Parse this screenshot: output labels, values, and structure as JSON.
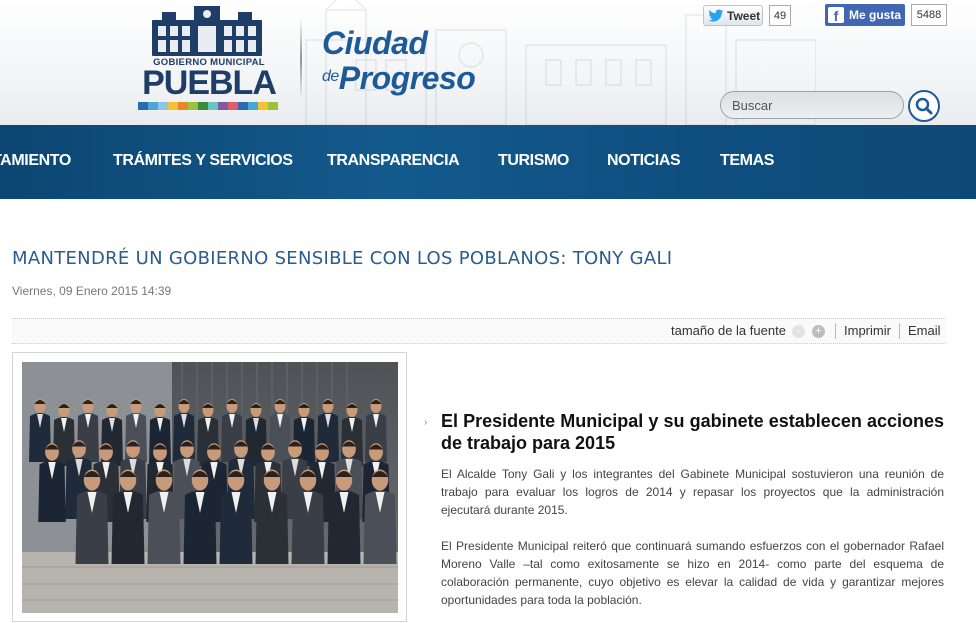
{
  "header": {
    "logo": {
      "line1": "GOBIERNO MUNICIPAL",
      "line2": "PUEBLA",
      "stripe_colors": [
        "#2b6cb0",
        "#49a7d8",
        "#8fc5e8",
        "#f2c230",
        "#e7862a",
        "#9bc23c",
        "#3b8c3a",
        "#6cc4c0",
        "#7c5aa6",
        "#e05b6c",
        "#2b6cb0",
        "#49a7d8",
        "#f2c230",
        "#9bc23c"
      ]
    },
    "slogan_line1": "Ciudad",
    "slogan_de": "de",
    "slogan_line2": "Progreso"
  },
  "social": {
    "tweet_label": "Tweet",
    "tweet_count": "49",
    "tweet_icon": "twitter-bird-icon",
    "like_label": "Me gusta",
    "like_count": "5488",
    "like_icon": "facebook-f-icon"
  },
  "search": {
    "placeholder": "Buscar",
    "icon": "search-icon"
  },
  "nav": {
    "items": [
      {
        "label": "TAMIENTO"
      },
      {
        "label": "TRÁMITES Y SERVICIOS"
      },
      {
        "label": "TRANSPARENCIA"
      },
      {
        "label": "TURISMO"
      },
      {
        "label": "NOTICIAS"
      },
      {
        "label": "TEMAS"
      }
    ]
  },
  "article": {
    "title": "MANTENDRÉ UN GOBIERNO SENSIBLE CON LOS POBLANOS: TONY GALI",
    "date": "Viernes, 09 Enero 2015 14:39",
    "tools": {
      "font_size_label": "tamaño de la fuente",
      "decrease": "-",
      "increase": "+",
      "print": "Imprimir",
      "email": "Email"
    },
    "headline": "El Presidente Municipal y su gabinete establecen acciones de trabajo para 2015",
    "paragraphs": [
      "El Alcalde Tony Gali y los integrantes del Gabinete Municipal sostuvieron una reunión de trabajo para evaluar los logros de 2014 y repasar los proyectos que la administración ejecutará durante 2015.",
      "El Presidente Municipal reiteró que continuará sumando esfuerzos con el gobernador Rafael Moreno Valle –tal como exitosamente se hizo en 2014- como parte del esquema de colaboración permanente, cuyo objetivo es elevar la calidad de vida y garantizar mejores oportunidades para toda la población."
    ]
  },
  "colors": {
    "brand_blue": "#1c5a9a",
    "nav_blue": "#135a8c",
    "title_blue": "#2a5c8f"
  }
}
